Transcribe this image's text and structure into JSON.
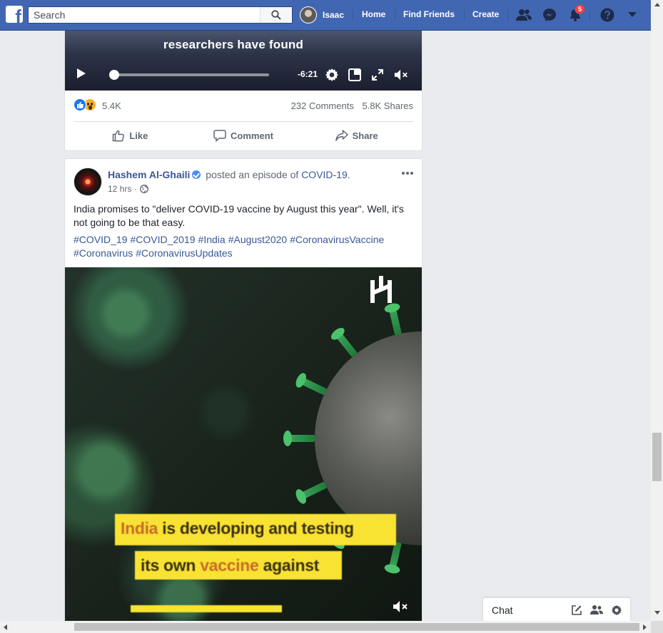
{
  "topbar": {
    "search_placeholder": "Search",
    "profile_name": "Isaac",
    "nav": [
      "Home",
      "Find Friends",
      "Create"
    ],
    "notifications_count": "5"
  },
  "post1": {
    "video_caption": "researchers have found",
    "video_time_remaining": "-6:21",
    "video_progress_fraction": 0.0,
    "reactions_count": "5.4K",
    "comments": "232 Comments",
    "shares": "5.8K Shares",
    "actions": {
      "like": "Like",
      "comment": "Comment",
      "share": "Share"
    }
  },
  "post2": {
    "author": "Hashem Al-Ghaili",
    "action_text": "posted an episode of",
    "episode_link": "COVID-19",
    "episode_suffix": ".",
    "time": "12 hrs",
    "time_sep": "·",
    "body": "India promises to \"deliver COVID-19 vaccine by August this year\". Well, it's not going to be that easy.",
    "hashtags": [
      "#COVID_19",
      "#COVID_2019",
      "#India",
      "#August2020",
      "#CoronavirusVaccine",
      "#Coronavirus",
      "#CoronavirusUpdates"
    ],
    "video_caption_line1_a": "India",
    "video_caption_line1_b": " is developing and testing",
    "video_caption_line2_a": "its own ",
    "video_caption_line2_b": "vaccine",
    "video_caption_line2_c": " against"
  },
  "chat": {
    "label": "Chat"
  },
  "colors": {
    "topbar": "#4267b2",
    "link": "#385898",
    "caption_yellow": "#f9e332",
    "badge": "#fa3e3e"
  },
  "icons": [
    "facebook-logo-icon",
    "search-icon",
    "friends-icon",
    "messenger-icon",
    "bell-icon",
    "help-icon",
    "caret-down-icon",
    "play-icon",
    "settings-gear-icon",
    "pip-icon",
    "fullscreen-icon",
    "mute-icon",
    "like-icon",
    "comment-icon",
    "share-icon",
    "globe-icon",
    "more-icon",
    "compose-icon",
    "group-icon"
  ]
}
